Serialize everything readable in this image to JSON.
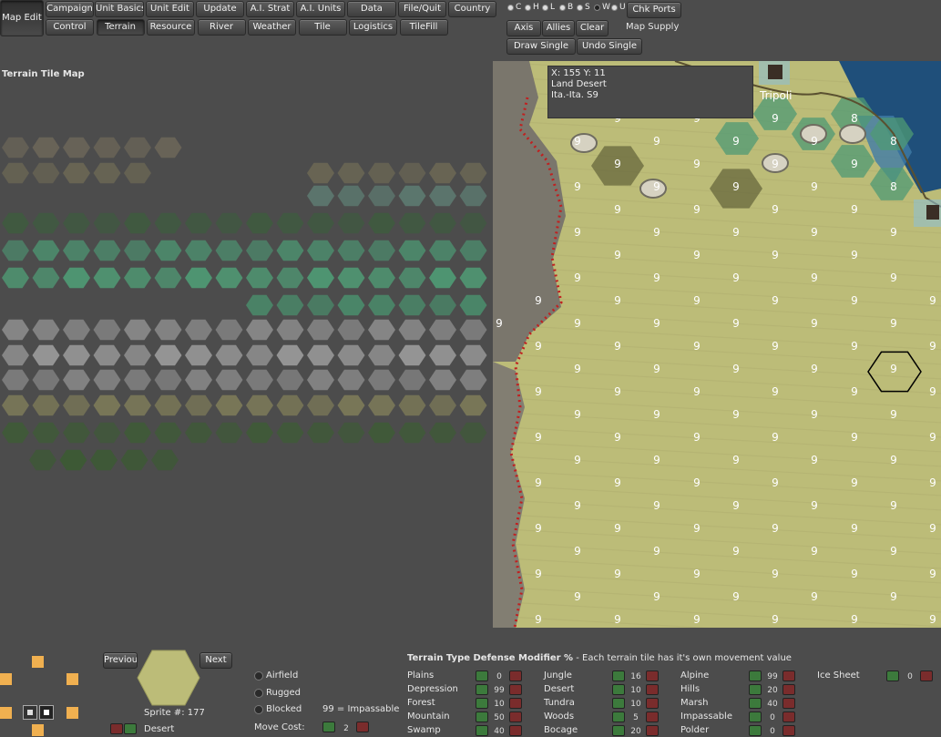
{
  "toolbar": {
    "map_edit": "Map Edit",
    "row1": [
      "Campaign",
      "Unit Basics",
      "Unit Edit",
      "Update",
      "A.I. Strat",
      "A.I. Units",
      "Data",
      "File/Quit",
      "Country"
    ],
    "row2": [
      "Control",
      "Terrain",
      "Resource",
      "River",
      "Weather",
      "Tile",
      "Logistics",
      "TileFill"
    ],
    "toggles": [
      {
        "letter": "C",
        "on": true
      },
      {
        "letter": "H",
        "on": true
      },
      {
        "letter": "L",
        "on": true
      },
      {
        "letter": "B",
        "on": true
      },
      {
        "letter": "S",
        "on": true
      },
      {
        "letter": "W",
        "on": false
      },
      {
        "letter": "U",
        "on": true
      }
    ],
    "chk_ports": "Chk Ports",
    "axis": "Axis",
    "allies": "Allies",
    "clear": "Clear",
    "map_supply": "Map Supply",
    "draw_single": "Draw Single",
    "undo_single": "Undo Single"
  },
  "tile_panel": {
    "title": "Terrain Tile Map"
  },
  "map": {
    "tooltip": {
      "coords": "X: 155 Y: 11",
      "terrain": "Land Desert",
      "owner": "Ita.-Ita.  S9"
    },
    "city_name": "Tripoli",
    "supply_value": "9",
    "coast_values": [
      "8",
      "8",
      "8",
      "8"
    ]
  },
  "sprite": {
    "previous": "Previous",
    "next": "Next",
    "number": "Sprite #: 177",
    "name": "Desert"
  },
  "flags": {
    "airfield": "Airfield",
    "rugged": "Rugged",
    "blocked": "Blocked",
    "impassable_note": "99 = Impassable",
    "move_cost_label": "Move Cost:",
    "move_cost_value": "2"
  },
  "defense": {
    "title": "Terrain Type Defense Modifier %",
    "subtitle": " - Each terrain tile has it's own movement value",
    "columns": [
      [
        {
          "name": "Plains",
          "value": "0"
        },
        {
          "name": "Depression",
          "value": "99"
        },
        {
          "name": "Forest",
          "value": "10"
        },
        {
          "name": "Mountain",
          "value": "50"
        },
        {
          "name": "Swamp",
          "value": "40"
        }
      ],
      [
        {
          "name": "Jungle",
          "value": "16"
        },
        {
          "name": "Desert",
          "value": "10"
        },
        {
          "name": "Tundra",
          "value": "10"
        },
        {
          "name": "Woods",
          "value": "5"
        },
        {
          "name": "Bocage",
          "value": "20"
        }
      ],
      [
        {
          "name": "Alpine",
          "value": "99"
        },
        {
          "name": "Hills",
          "value": "20"
        },
        {
          "name": "Marsh",
          "value": "40"
        },
        {
          "name": "Impassable",
          "value": "0"
        },
        {
          "name": "Polder",
          "value": "0"
        }
      ],
      [
        {
          "name": "Ice Sheet",
          "value": "0"
        }
      ]
    ]
  },
  "colors": {
    "background": "#4c4c4c",
    "desert": "#bcbc78",
    "sea": "#1f4f7a",
    "hex_green": "#4f9a74",
    "border_dot": "#c02020"
  }
}
